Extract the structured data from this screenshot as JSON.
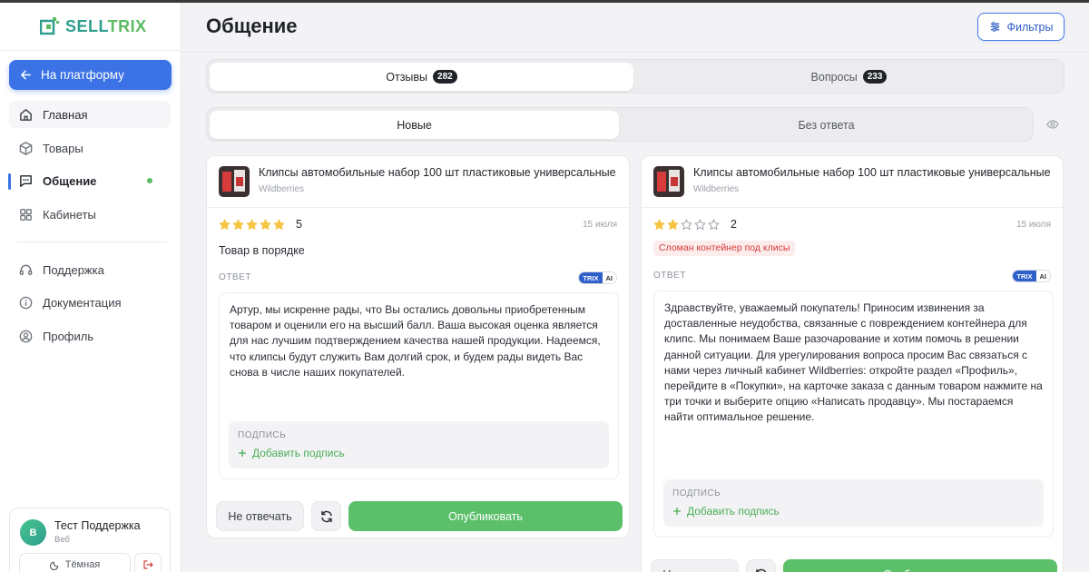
{
  "brand": {
    "name_part1": "SELL",
    "name_part2": "TRIX"
  },
  "sidebar": {
    "platform_button": "На платформу",
    "items": [
      {
        "label": "Главная",
        "icon": "home-icon"
      },
      {
        "label": "Товары",
        "icon": "box-icon"
      },
      {
        "label": "Общение",
        "icon": "chat-icon"
      },
      {
        "label": "Кабинеты",
        "icon": "grid-icon"
      },
      {
        "label": "Поддержка",
        "icon": "headset-icon"
      },
      {
        "label": "Документация",
        "icon": "info-icon"
      },
      {
        "label": "Профиль",
        "icon": "user-circle-icon"
      }
    ],
    "active_item": "Общение",
    "user": {
      "initial": "B",
      "name": "Тест Поддержка",
      "subtitle": "Веб",
      "theme_button": "Тёмная"
    }
  },
  "header": {
    "title": "Общение",
    "filters_button": "Фильтры"
  },
  "tabs_primary": [
    {
      "label": "Отзывы",
      "count": "282",
      "selected": true
    },
    {
      "label": "Вопросы",
      "count": "233",
      "selected": false
    }
  ],
  "tabs_secondary": [
    {
      "label": "Новые",
      "selected": true
    },
    {
      "label": "Без ответа",
      "selected": false
    }
  ],
  "reviews": [
    {
      "product_title": "Клипсы автомобильные набор 100 шт пластиковые универсальные",
      "marketplace": "Wildberries",
      "rating": "5",
      "stars_filled": 5,
      "date": "15 июля",
      "text": "Товар в порядке",
      "answer_label": "ОТВЕТ",
      "ai_badge": {
        "brand": "TRIX",
        "suffix": "AI"
      },
      "answer": "Артур, мы искренне рады, что Вы остались довольны приобретенным товаром и оценили его на высший балл. Ваша высокая оценка является для нас лучшим подтверждением качества нашей продукции. Надеемся, что клипсы будут служить Вам долгий срок, и будем рады видеть Вас снова в числе наших покупателей.",
      "signature_label": "ПОДПИСЬ",
      "signature_add": "Добавить подпись",
      "skip_button": "Не отвечать",
      "publish_button": "Опубликовать"
    },
    {
      "product_title": "Клипсы автомобильные набор 100 шт пластиковые универсальные",
      "marketplace": "Wildberries",
      "rating": "2",
      "stars_filled": 2,
      "date": "15 июля",
      "tag": "Сломан контейнер под клисы",
      "answer_label": "ОТВЕТ",
      "ai_badge": {
        "brand": "TRIX",
        "suffix": "AI"
      },
      "answer": "Здравствуйте, уважаемый покупатель! Приносим извинения за доставленные неудобства, связанные с повреждением контейнера для клипс. Мы понимаем Ваше разочарование и хотим помочь в решении данной ситуации. Для урегулирования вопроса просим Вас связаться с нами через личный кабинет Wildberries: откройте раздел «Профиль», перейдите в «Покупки», на карточке заказа с данным товаром нажмите на три точки и выберите опцию «Написать продавцу». Мы постараемся найти оптимальное решение.",
      "signature_label": "ПОДПИСЬ",
      "signature_add": "Добавить подпись",
      "skip_button": "Не отвечать",
      "publish_button": "Опубликовать"
    }
  ],
  "colors": {
    "accent": "#3b73e6",
    "publish": "#5cc06b",
    "star": "#f5c542",
    "tag_text": "#d43a3a"
  }
}
